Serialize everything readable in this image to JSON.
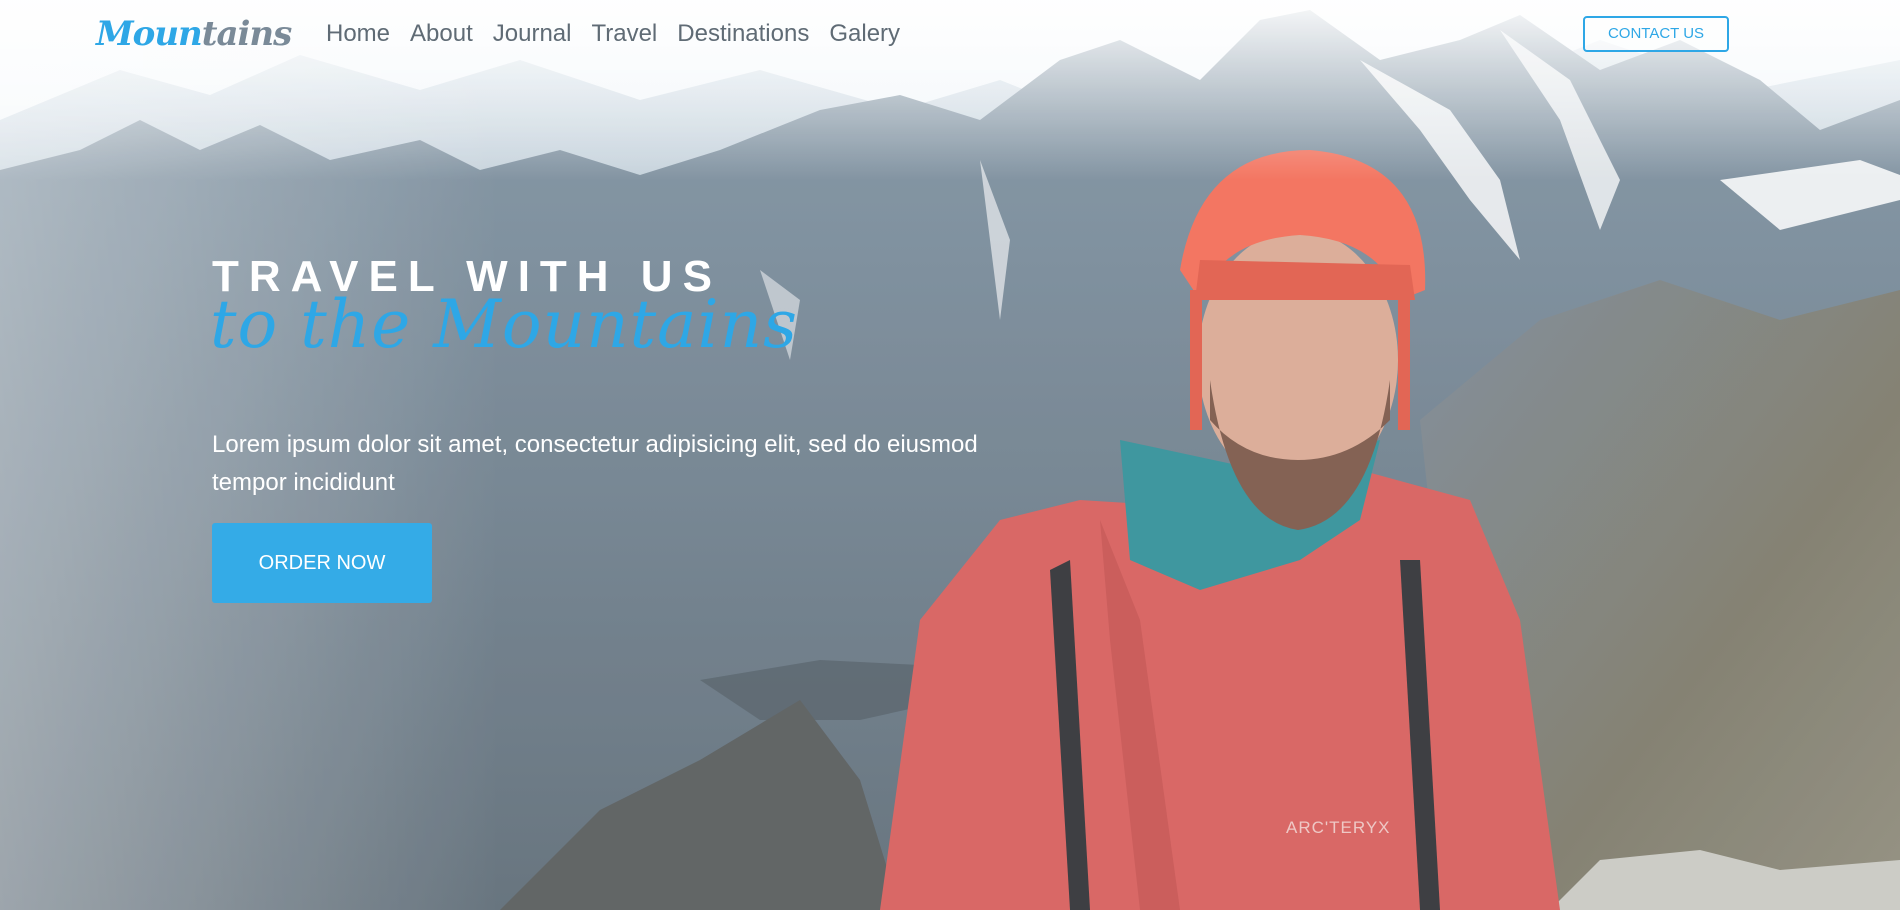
{
  "brand": {
    "logo_part1": "Moun",
    "logo_part2": "tains"
  },
  "nav": {
    "items": [
      {
        "label": "Home"
      },
      {
        "label": "About"
      },
      {
        "label": "Journal"
      },
      {
        "label": "Travel"
      },
      {
        "label": "Destinations"
      },
      {
        "label": "Galery"
      }
    ],
    "contact_label": "CONTACT US"
  },
  "hero": {
    "headline": "TRAVEL WITH US",
    "script_line": "to the Mountains",
    "lead_text": "Lorem ipsum dolor sit amet, consectetur adipisicing elit, sed do eiusmod tempor incididunt",
    "cta_label": "ORDER NOW",
    "jacket_brand": "ARC'TERYX"
  },
  "colors": {
    "accent": "#2ea7e6",
    "jacket": "#d95a57",
    "helmet": "#f26b55"
  }
}
